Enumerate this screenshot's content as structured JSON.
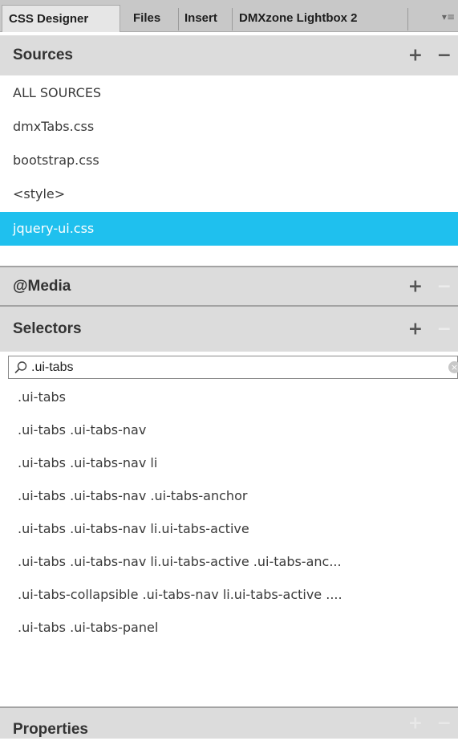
{
  "tabs": [
    {
      "label": "CSS Designer",
      "active": true
    },
    {
      "label": "Files",
      "active": false
    },
    {
      "label": "Insert",
      "active": false
    },
    {
      "label": "DMXzone Lightbox 2",
      "active": false
    }
  ],
  "tab_menu_icon": "▾≡",
  "sources": {
    "title": "Sources",
    "add_icon": "+",
    "remove_icon": "−",
    "items": [
      {
        "label": "ALL SOURCES"
      },
      {
        "label": "dmxTabs.css"
      },
      {
        "label": "bootstrap.css"
      },
      {
        "label": "<style>"
      },
      {
        "label": "jquery-ui.css",
        "selected": true
      }
    ]
  },
  "media": {
    "title": "@Media",
    "add_icon": "+",
    "remove_icon": "−"
  },
  "selectors": {
    "title": "Selectors",
    "add_icon": "+",
    "remove_icon": "−",
    "search_value": ".ui-tabs",
    "clear_icon": "×",
    "items": [
      ".ui-tabs",
      ".ui-tabs .ui-tabs-nav",
      ".ui-tabs .ui-tabs-nav li",
      ".ui-tabs .ui-tabs-nav .ui-tabs-anchor",
      ".ui-tabs .ui-tabs-nav li.ui-tabs-active",
      ".ui-tabs .ui-tabs-nav li.ui-tabs-active .ui-tabs-anc...",
      ".ui-tabs-collapsible .ui-tabs-nav li.ui-tabs-active ....",
      ".ui-tabs .ui-tabs-panel"
    ]
  },
  "properties": {
    "title": "Properties",
    "add_icon": "+",
    "remove_icon": "−"
  },
  "colors": {
    "accent": "#1fc0ee",
    "header_bg": "#dcdcdc",
    "tabbar_bg": "#c8c8c8"
  }
}
